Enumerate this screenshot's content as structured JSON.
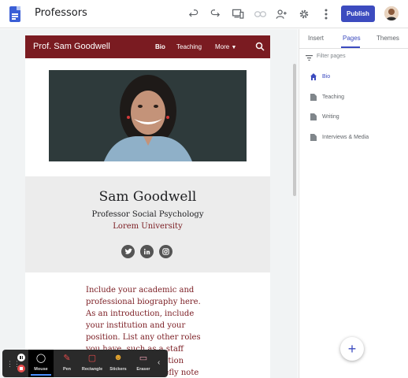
{
  "app": {
    "title": "Professors",
    "publish_label": "Publish",
    "icons": [
      "undo-icon",
      "redo-icon",
      "preview-devices-icon",
      "link-icon",
      "share-icon",
      "gear-icon",
      "more-vert-icon"
    ]
  },
  "site": {
    "name": "Prof. Sam Goodwell",
    "nav": [
      "Bio",
      "Teaching",
      "More"
    ],
    "person_name": "Sam Goodwell",
    "role": "Professor Social Psychology",
    "university": "Lorem University",
    "social": [
      "twitter-icon",
      "linkedin-icon",
      "instagram-icon"
    ],
    "bio_lines": [
      "Include your academic and",
      "professional biography here.",
      "As an introduction, include",
      "your institution and your",
      "position. List any other roles",
      "you have, such as a staff",
      "member of a publication",
      "or society. You'll briefly note"
    ],
    "colors": {
      "brand": "#7a1b21",
      "accent": "#3c4bbf"
    }
  },
  "panel": {
    "tabs": [
      "Insert",
      "Pages",
      "Themes"
    ],
    "active_tab": "Pages",
    "filter_placeholder": "Filter pages",
    "pages": [
      "Bio",
      "Teaching",
      "Writing",
      "Interviews & Media"
    ],
    "home_page": "Bio"
  },
  "annotation_toolbar": {
    "tools": [
      "Mouse",
      "Pen",
      "Rectangle",
      "Stickers",
      "Eraser"
    ],
    "active_tool": "Mouse"
  },
  "fab_label": "+"
}
